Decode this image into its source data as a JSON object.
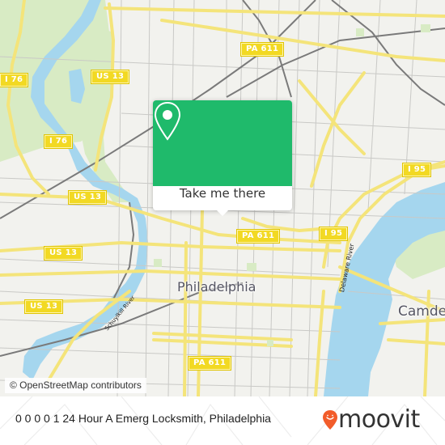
{
  "map": {
    "city_labels": {
      "philadelphia": "Philadelphia",
      "camden": "Camde"
    },
    "river_labels": {
      "delaware": "Delaware River",
      "schuylkill": "Schuylkill River"
    },
    "shields": {
      "pa611_top": "PA 611",
      "pa611_mid": "PA 611",
      "pa611_bottom": "PA 611",
      "us13_top": "US 13",
      "us13_mid": "US 13",
      "us13_west": "US 13",
      "us13_sw": "US 13",
      "i76_top": "I 76",
      "i76_mid": "I 76",
      "i95_east": "I 95",
      "i95_mid": "I 95"
    },
    "attribution": "© OpenStreetMap contributors",
    "colors": {
      "land": "#f2f2ee",
      "water": "#a5d6ee",
      "park": "#d8ebc4",
      "major_road": "#f4e47a",
      "minor_road": "#c8c8c8",
      "rail": "#7a7a7a"
    }
  },
  "popup": {
    "icon": "map-pin-icon",
    "button_label": "Take me there",
    "color": "#1fba6b"
  },
  "footer": {
    "title": "0 0 0 0 1 24 Hour A Emerg Locksmith, Philadelphia",
    "brand": "moovit",
    "brand_icon": "moovit-pin-icon",
    "brand_color": "#f25c2a"
  }
}
